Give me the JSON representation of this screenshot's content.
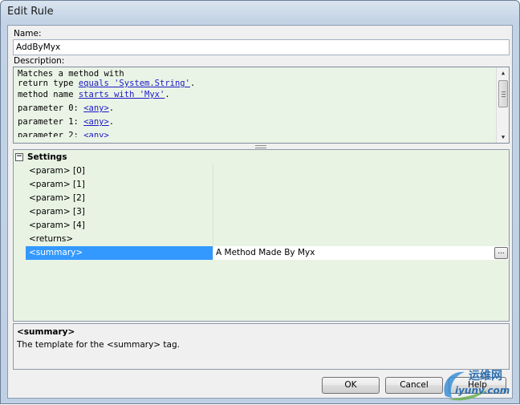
{
  "window": {
    "title": "Edit Rule"
  },
  "name_field": {
    "label": "Name:",
    "value": "AddByMyx"
  },
  "description": {
    "label": "Description:",
    "lines": [
      {
        "text": "Matches a method with",
        "link": "",
        "suffix": ""
      },
      {
        "text": "return type ",
        "link": "equals 'System.String'",
        "suffix": "."
      },
      {
        "text": "method name ",
        "link": "starts with 'Myx'",
        "suffix": "."
      },
      {
        "text": "parameter 0: ",
        "link": "<any>",
        "suffix": "."
      },
      {
        "text": "parameter 1: ",
        "link": "<any>",
        "suffix": "."
      },
      {
        "text": "parameter 2: ",
        "link": "<any>",
        "suffix": ""
      }
    ]
  },
  "settings": {
    "header": "Settings",
    "toggle_symbol": "−",
    "items": [
      {
        "name": "<param> [0]",
        "value": ""
      },
      {
        "name": "<param> [1]",
        "value": ""
      },
      {
        "name": "<param> [2]",
        "value": ""
      },
      {
        "name": "<param> [3]",
        "value": ""
      },
      {
        "name": "<param> [4]",
        "value": ""
      },
      {
        "name": "<returns>",
        "value": ""
      },
      {
        "name": "<summary>",
        "value": "A Method Made By Myx",
        "selected": true,
        "button": "..."
      }
    ]
  },
  "info": {
    "title": "<summary>",
    "text": "The template for the <summary> tag."
  },
  "buttons": {
    "ok": "OK",
    "cancel": "Cancel",
    "help": "Help"
  },
  "watermark": {
    "top": "运维网",
    "bottom": "iyunv.com"
  },
  "colors": {
    "grid_background": "#e8f3e4",
    "description_background": "#eaf4e6",
    "selection": "#3399ff",
    "link": "#1a18c6"
  }
}
